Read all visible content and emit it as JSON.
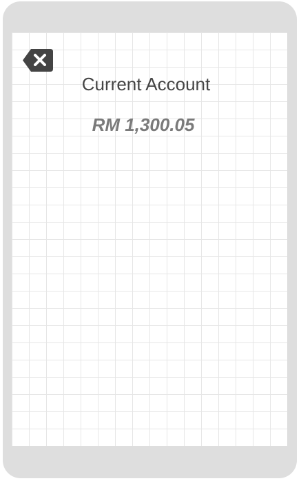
{
  "screen": {
    "close_icon": "backspace-x-icon",
    "title": "Current Account",
    "balance": "RM 1,300.05"
  },
  "colors": {
    "frame": "#dedede",
    "grid_line": "#e6e6e6",
    "close_button": "#444444",
    "title_text": "#444444",
    "balance_text": "#7a7a7a"
  }
}
